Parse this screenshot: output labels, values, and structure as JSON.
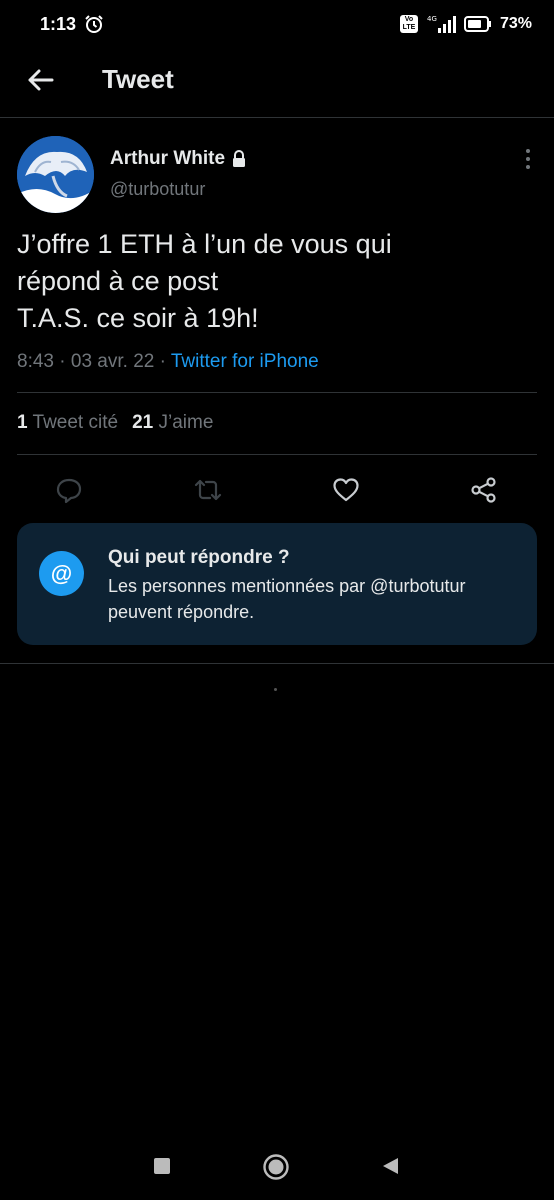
{
  "status_bar": {
    "time": "1:13",
    "network": "4G",
    "volte": "Vo LTE",
    "battery": "73%"
  },
  "header": {
    "title": "Tweet"
  },
  "tweet": {
    "author_name": "Arthur White",
    "author_handle": "@turbotutur",
    "text_lines": [
      "J’offre 1 ETH à l’un de vous qui",
      "répond à ce post",
      "T.A.S. ce soir à 19h!"
    ],
    "time": "8:43",
    "date": "03 avr. 22",
    "separator": "·",
    "source": "Twitter for iPhone",
    "quote_count": "1",
    "quote_label": "Tweet cité",
    "like_count": "21",
    "like_label": "J’aime"
  },
  "reply_card": {
    "icon": "@",
    "title": "Qui peut répondre ?",
    "description": "Les personnes mentionnées par @turbotutur peuvent répondre."
  },
  "colors": {
    "accent": "#1d9bf0",
    "background": "#000000",
    "card": "#0d2233",
    "muted": "#71767b"
  }
}
